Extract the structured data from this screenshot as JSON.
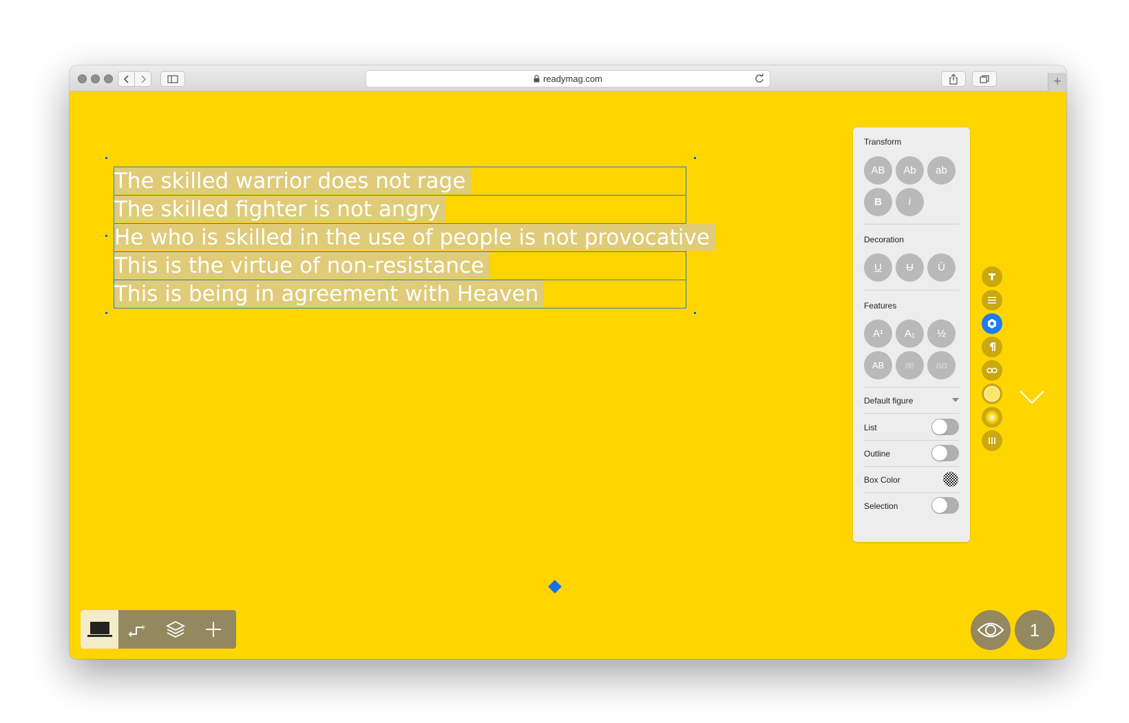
{
  "browser": {
    "url": "readymag.com",
    "icons": [
      "back-icon",
      "forward-icon",
      "sidebar-icon",
      "lock-icon",
      "reload-icon",
      "share-icon",
      "tabs-icon",
      "new-tab-icon"
    ]
  },
  "text_block": {
    "lines": [
      "The skilled warrior does not rage",
      "The skilled fighter is not angry",
      "He who is skilled in the use of people is not provocative",
      "This is the virtue of non-resistance",
      "This is being in agreement with Heaven"
    ]
  },
  "panel": {
    "transform": {
      "title": "Transform",
      "buttons": [
        "AB",
        "Ab",
        "ab",
        "B",
        "i"
      ]
    },
    "decoration": {
      "title": "Decoration",
      "buttons": [
        "U",
        "U",
        "Ū"
      ]
    },
    "features": {
      "title": "Features",
      "buttons": [
        "A¹",
        "A₁",
        "½",
        "AB",
        "æ",
        "aɑ"
      ]
    },
    "figure_select": "Default figure",
    "list_label": "List",
    "outline_label": "Outline",
    "box_color_label": "Box Color",
    "selection_label": "Selection",
    "toggles": {
      "list": false,
      "outline": false,
      "selection": false
    }
  },
  "side_tools": [
    "text-type-icon",
    "align-icon",
    "style-icon",
    "paragraph-icon",
    "link-icon",
    "color-icon",
    "glow-icon",
    "columns-icon"
  ],
  "bottom_toolbar": [
    "desktop-icon",
    "transition-icon",
    "layers-icon",
    "add-icon"
  ],
  "preview_button": "eye-icon",
  "page_number": "1",
  "colors": {
    "canvas": "#FFD500",
    "text_highlight": "#DFCB78",
    "active": "#1e7cf0",
    "toolbar": "#93885F"
  }
}
